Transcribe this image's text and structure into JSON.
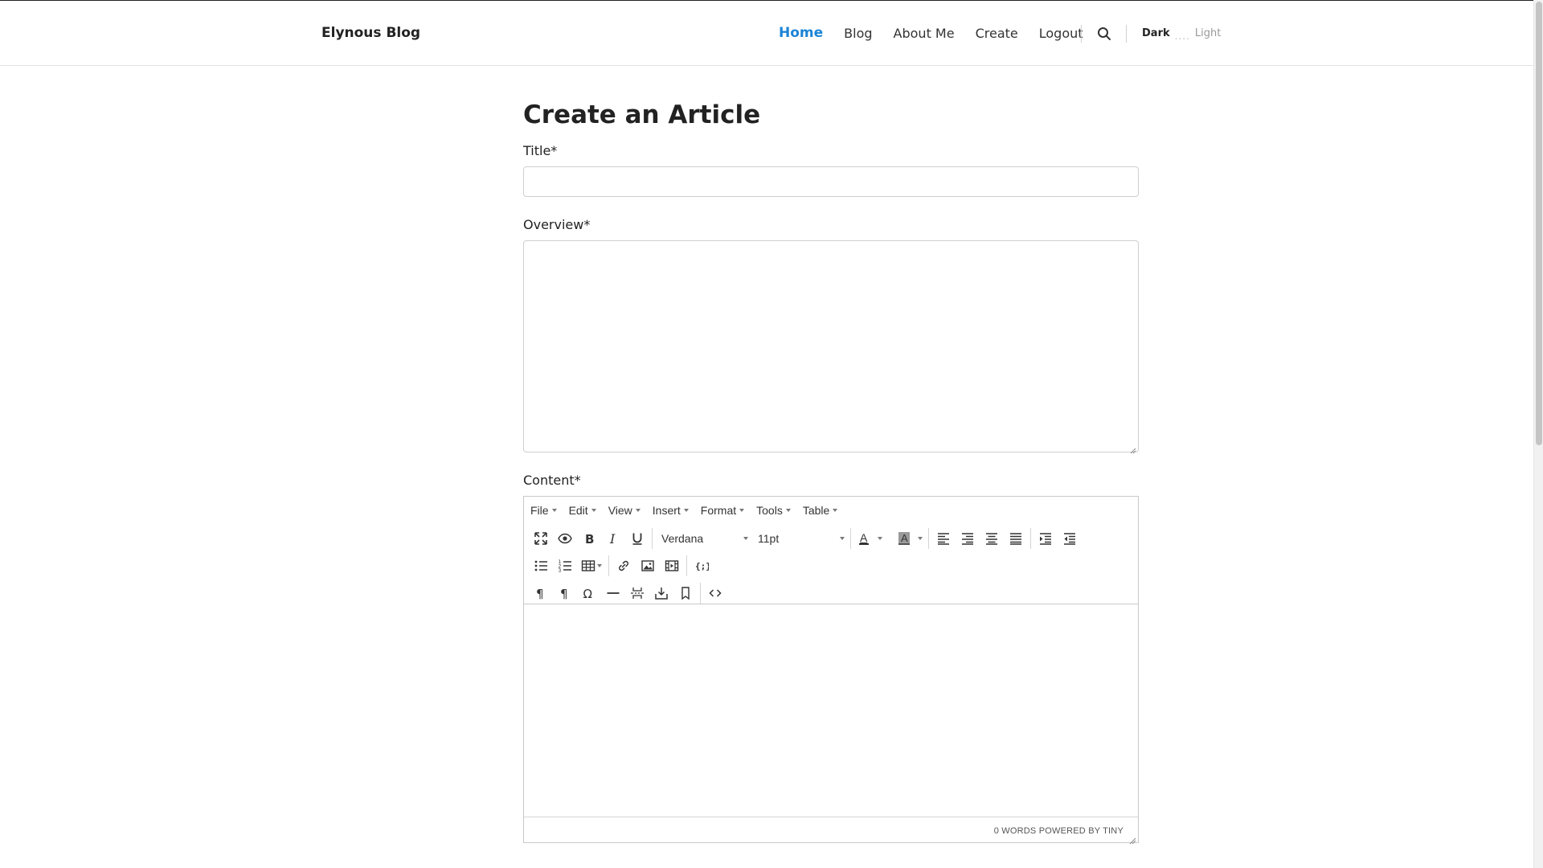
{
  "brand": "Elynous Blog",
  "nav": {
    "items": [
      {
        "label": "Home",
        "active": true
      },
      {
        "label": "Blog",
        "active": false
      },
      {
        "label": "About Me",
        "active": false
      },
      {
        "label": "Create",
        "active": false
      },
      {
        "label": "Logout",
        "active": false
      }
    ],
    "search_icon": "search-icon",
    "mode_dark": "Dark",
    "mode_dots": "....",
    "mode_light": "Light"
  },
  "colors": {
    "accent": "#1b84d6",
    "text": "#222222",
    "border": "#cfcfcf"
  },
  "form": {
    "page_title": "Create an Article",
    "title_label": "Title*",
    "title_value": "",
    "overview_label": "Overview*",
    "overview_value": "",
    "content_label": "Content*"
  },
  "editor": {
    "menus": [
      "File",
      "Edit",
      "View",
      "Insert",
      "Format",
      "Tools",
      "Table"
    ],
    "font_family": "Verdana",
    "font_size": "11pt",
    "toolbar_row1": [
      "fullscreen-icon",
      "preview-icon",
      "bold-icon",
      "italic-icon",
      "underline-icon",
      "font-family-select",
      "font-size-select",
      "text-color-icon",
      "background-color-icon",
      "align-left-icon",
      "align-right-icon",
      "align-center-icon",
      "align-justify-icon",
      "indent-icon",
      "outdent-icon"
    ],
    "toolbar_row2": [
      "bullet-list-icon",
      "numbered-list-icon",
      "table-icon",
      "link-icon",
      "image-icon",
      "media-icon",
      "template-icon"
    ],
    "toolbar_row3": [
      "ltr-icon",
      "rtl-icon",
      "special-char-icon",
      "horizontal-rule-icon",
      "page-break-icon",
      "insert-datetime-icon",
      "anchor-icon",
      "code-icon"
    ],
    "word_count": "0 WORDS",
    "powered_by": "POWERED BY TINY"
  }
}
